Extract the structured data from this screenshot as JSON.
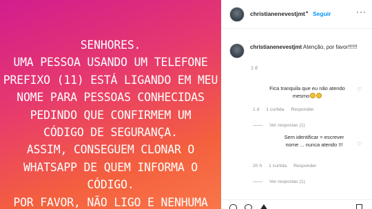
{
  "post": {
    "lines": [
      "SENHORES.",
      "UMA PESSOA USANDO UM TELEFONE",
      "PREFIXO (11) ESTÁ LIGANDO EM MEU",
      "NOME PARA PESSOAS CONHECIDAS",
      "PEDINDO QUE CONFIRMEM UM",
      "CÓDIGO DE SEGURANÇA.",
      "ASSIM, CONSEGUEM CLONAR O",
      "WHATSAPP DE QUEM INFORMA O",
      "CÓDIGO.",
      "POR FAVOR, NÃO LIGO E NENHUMA"
    ]
  },
  "header": {
    "username": "christianenevestjmt",
    "separator": "•",
    "follow_label": "Seguir",
    "more_label": "···"
  },
  "caption": {
    "username": "christianenevestjmt",
    "text": "Atenção, por favor!!!!!!",
    "time": "1 d"
  },
  "replies": [
    {
      "text": "Fica tranquila que eu não atendo mesmo",
      "emoji_count": 2,
      "time": "1 d",
      "likes": "1 curtida",
      "reply_label": "Responder",
      "view_replies": "Ver respostas (1)"
    },
    {
      "text": "Sem identificar = escrever nome ... nunca atendo !!!",
      "time": "20 h",
      "likes": "1 curtida",
      "reply_label": "Responder",
      "view_replies": "Ver respostas (1)"
    }
  ],
  "icons": {
    "heart": "♡"
  },
  "colors": {
    "follow": "#0095f6",
    "gradient_start": "#d21d8e",
    "gradient_end": "#f9764a"
  }
}
